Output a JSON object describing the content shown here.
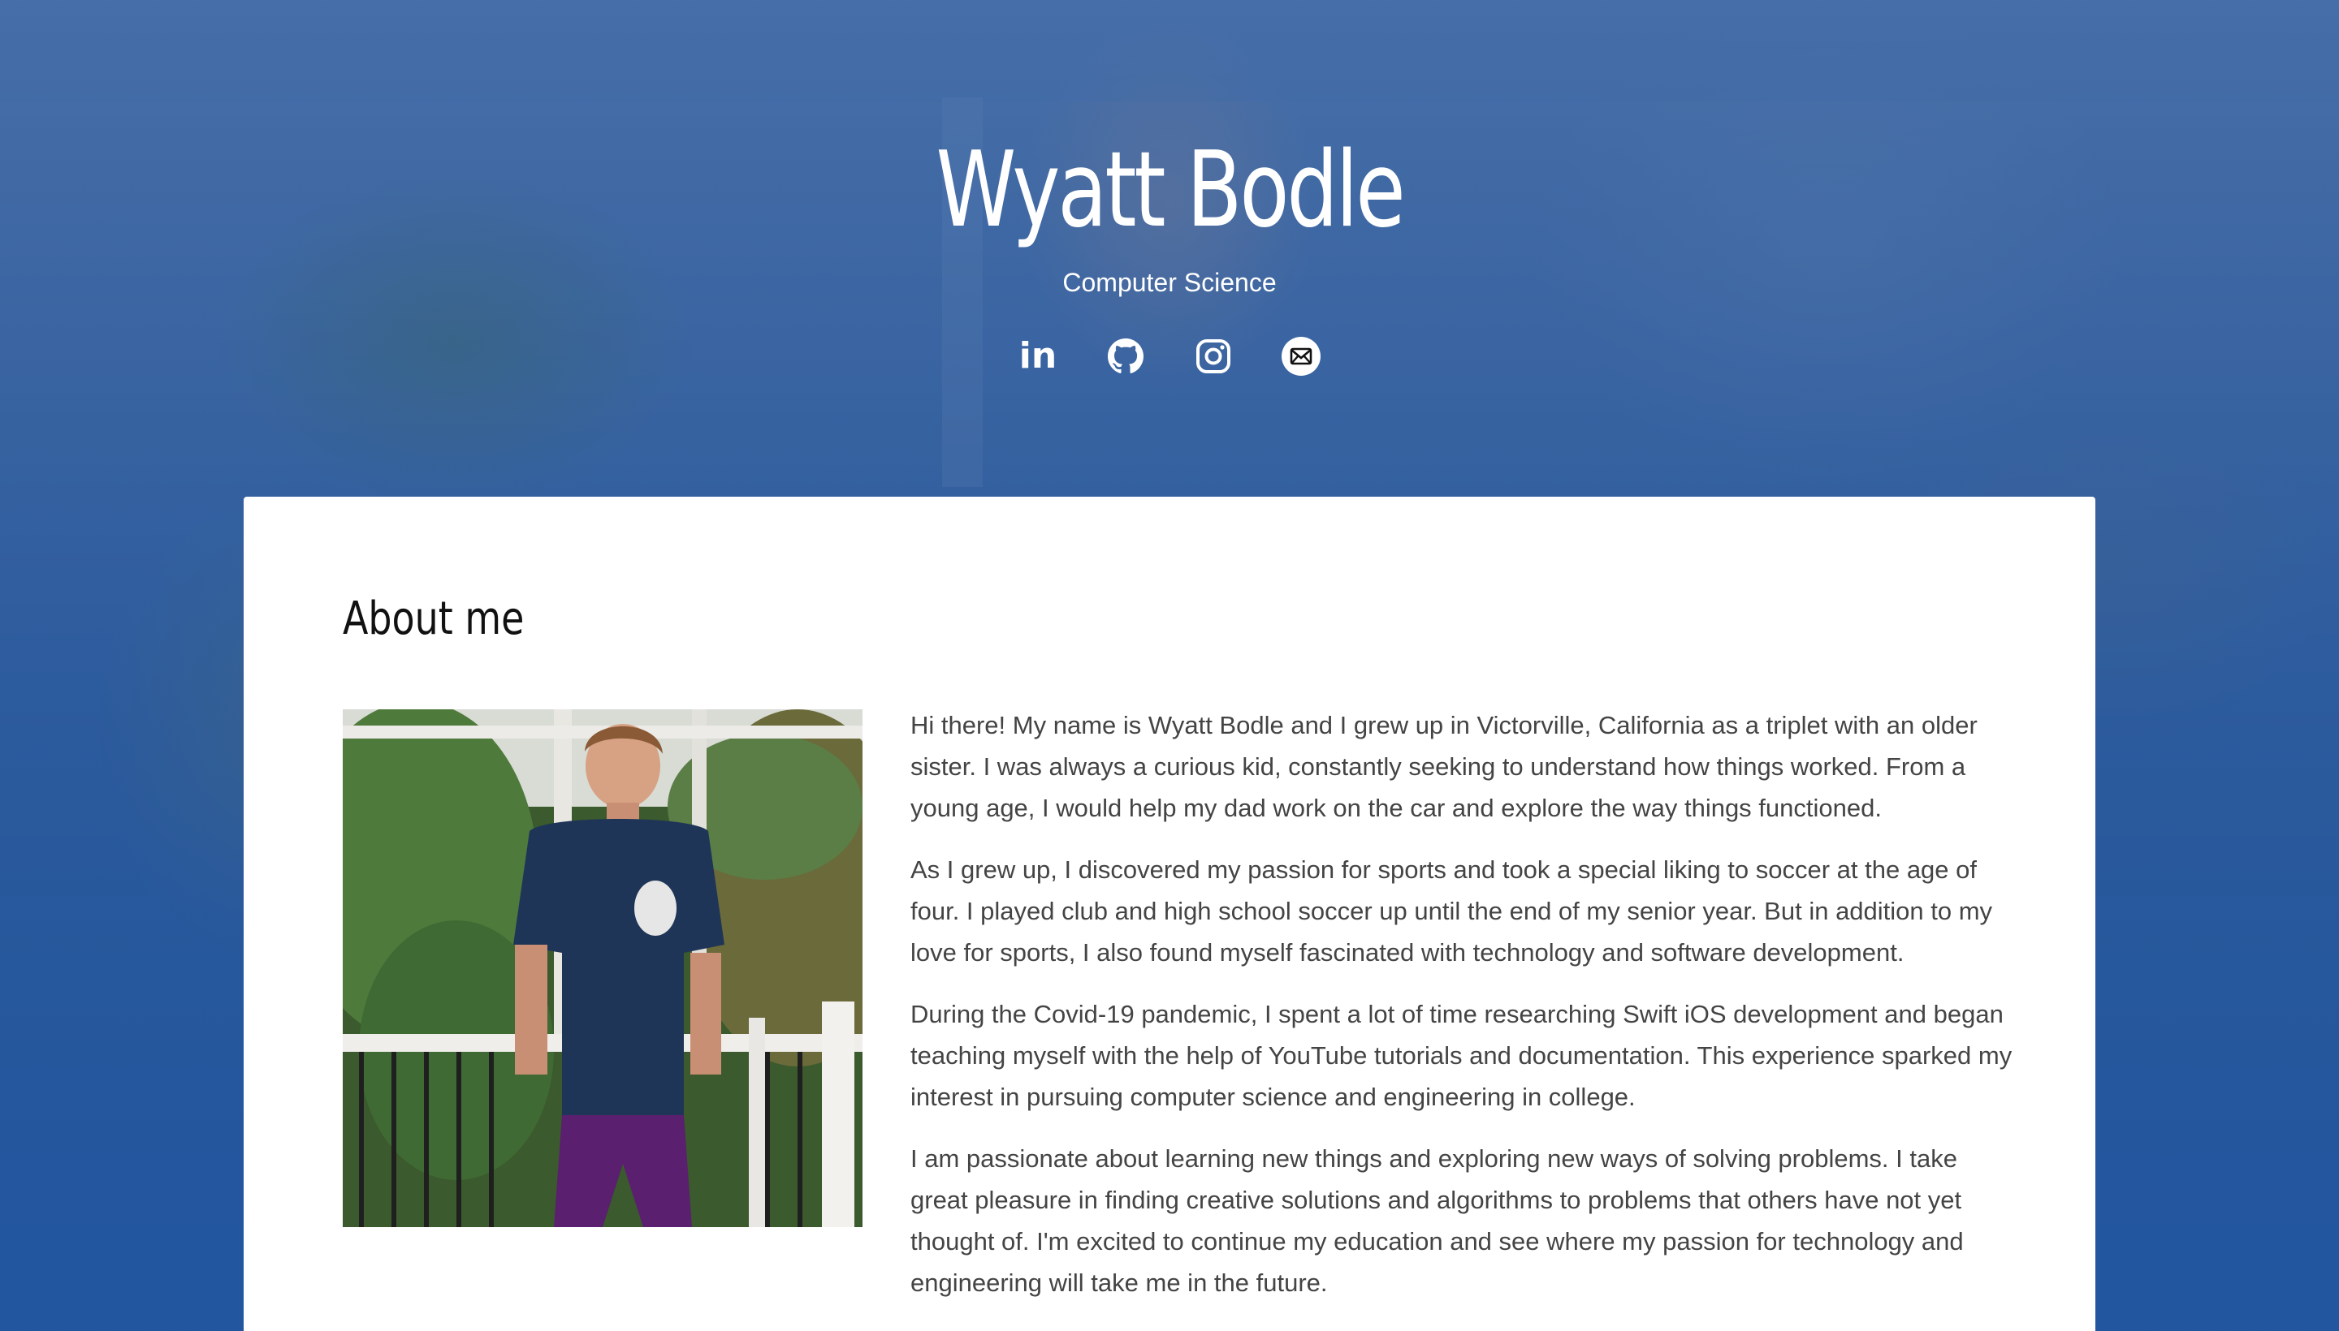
{
  "header": {
    "name": "Wyatt Bodle",
    "subtitle": "Computer Science",
    "socials": [
      {
        "icon": "linkedin-icon",
        "label": "in"
      },
      {
        "icon": "github-icon"
      },
      {
        "icon": "instagram-icon"
      },
      {
        "icon": "email-icon"
      }
    ]
  },
  "about": {
    "title": "About me",
    "photo_alt": "Wyatt Bodle",
    "paragraphs": [
      "Hi there! My name is Wyatt Bodle and I grew up in Victorville, California as a triplet with an older sister. I was always a curious kid, constantly seeking to understand how things worked. From a young age, I would help my dad work on the car and explore the way things functioned.",
      "As I grew up, I discovered my passion for sports and took a special liking to soccer at the age of four. I played club and high school soccer up until the end of my senior year. But in addition to my love for sports, I also found myself fascinated with technology and software development.",
      "During the Covid-19 pandemic, I spent a lot of time researching Swift iOS development and began teaching myself with the help of YouTube tutorials and documentation. This experience sparked my interest in pursuing computer science and engineering in college.",
      "I am passionate about learning new things and exploring new ways of solving problems. I take great pleasure in finding creative solutions and algorithms to problems that others have not yet thought of. I'm excited to continue my education and see where my passion for technology and engineering will take me in the future."
    ]
  },
  "colors": {
    "hero_blue": "#2a5ea4",
    "card": "#ffffff",
    "text": "#444444"
  }
}
